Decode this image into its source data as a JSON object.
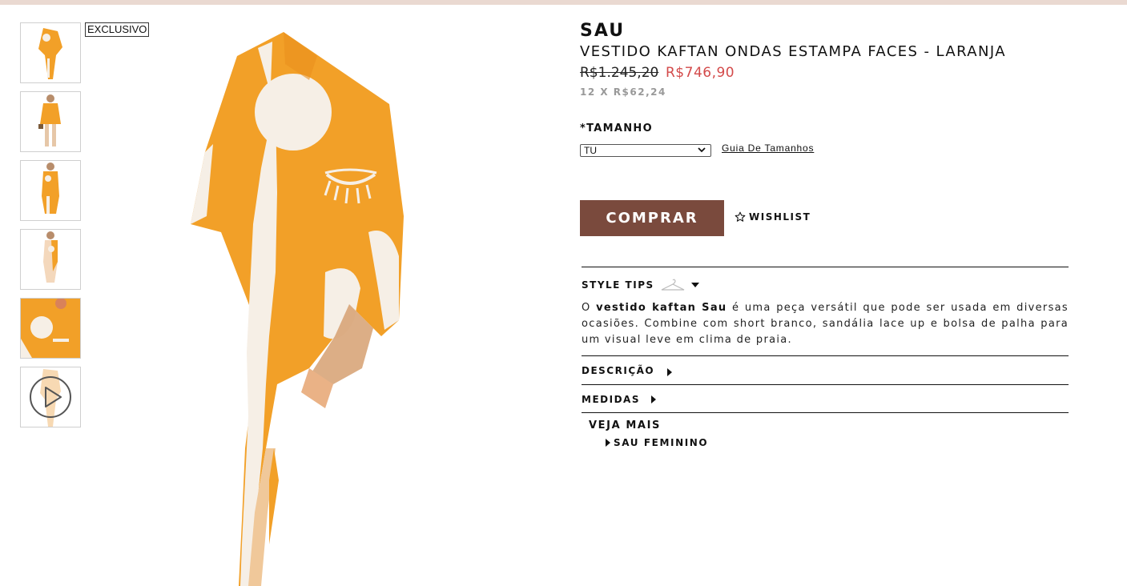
{
  "badge": "EXCLUSIVO",
  "product": {
    "brand": "SAU",
    "name": "VESTIDO KAFTAN ONDAS ESTAMPA FACES - LARANJA",
    "old_price": "R$1.245,20",
    "new_price": "R$746,90",
    "installments": "12 X R$62,24"
  },
  "size": {
    "label": "*TAMANHO",
    "selected": "TU",
    "guide_link": "Guia De Tamanhos"
  },
  "actions": {
    "buy": "COMPRAR",
    "wishlist": "WISHLIST"
  },
  "style_tips": {
    "title": "STYLE TIPS",
    "text_prefix": "O",
    "text_bold": "vestido kaftan Sau",
    "text_rest": "é uma peça versátil que pode ser usada em diversas ocasiões. Combine com short branco, sandália lace up e bolsa de palha para um visual leve em clima de praia."
  },
  "accordions": {
    "description": "DESCRIÇÃO",
    "measures": "MEDIDAS"
  },
  "see_more": {
    "title": "VEJA MAIS",
    "link": "SAU FEMININO"
  },
  "colors": {
    "dress_orange": "#f2a028",
    "print_white": "#f6efe6",
    "buy_button": "#7a4a3d",
    "sale_price": "#d34a4a",
    "top_bar": "#ead9d1"
  },
  "icons": [
    "play-icon",
    "star-icon",
    "hanger-icon",
    "caret-down-icon",
    "caret-right-icon",
    "chevron-down-icon"
  ]
}
